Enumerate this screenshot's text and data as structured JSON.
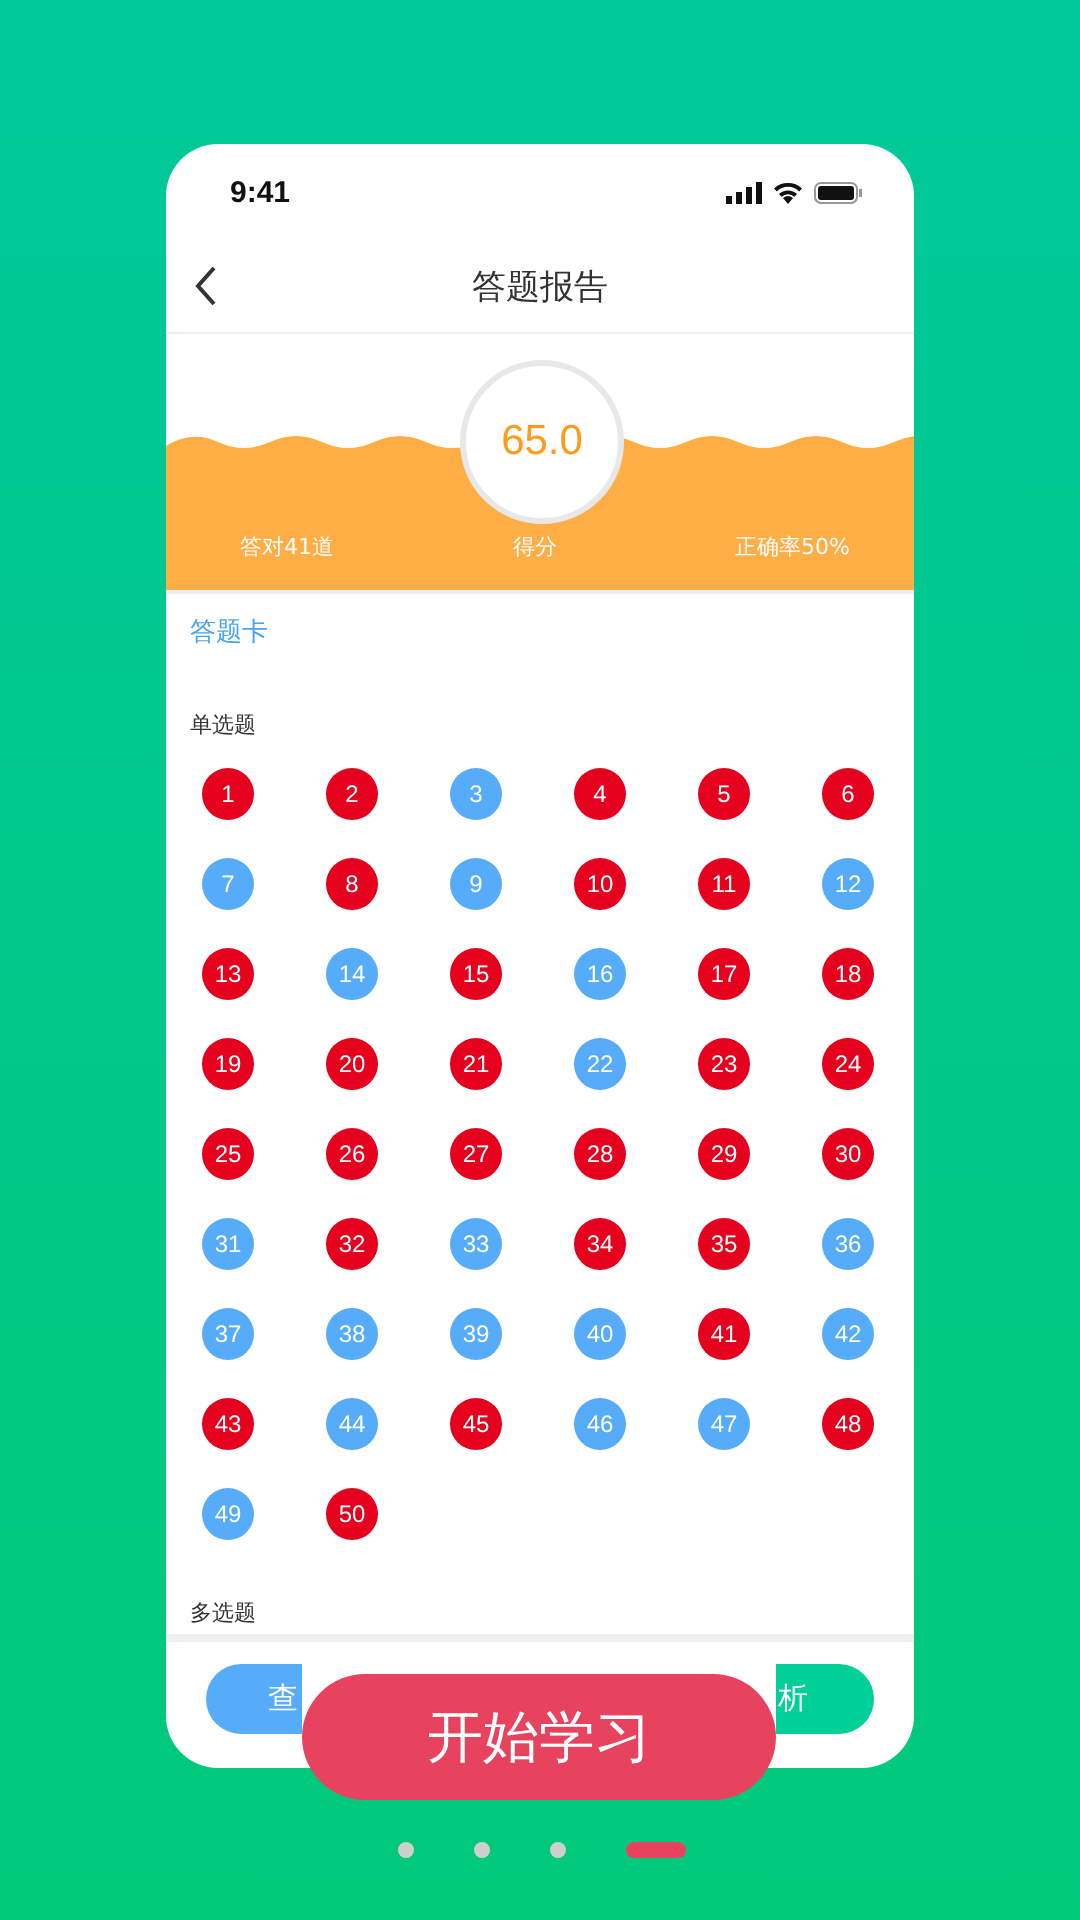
{
  "status_bar": {
    "time": "9:41"
  },
  "nav": {
    "title": "答题报告"
  },
  "score": {
    "value": "65.0",
    "correct_label": "答对41道",
    "score_label": "得分",
    "rate_label": "正确率50%"
  },
  "answer_card": {
    "title": "答题卡"
  },
  "sections": [
    {
      "title": "单选题",
      "questions": [
        {
          "number": "1",
          "correct": false
        },
        {
          "number": "2",
          "correct": false
        },
        {
          "number": "3",
          "correct": true
        },
        {
          "number": "4",
          "correct": false
        },
        {
          "number": "5",
          "correct": false
        },
        {
          "number": "6",
          "correct": false
        },
        {
          "number": "7",
          "correct": true
        },
        {
          "number": "8",
          "correct": false
        },
        {
          "number": "9",
          "correct": true
        },
        {
          "number": "10",
          "correct": false
        },
        {
          "number": "11",
          "correct": false
        },
        {
          "number": "12",
          "correct": true
        },
        {
          "number": "13",
          "correct": false
        },
        {
          "number": "14",
          "correct": true
        },
        {
          "number": "15",
          "correct": false
        },
        {
          "number": "16",
          "correct": true
        },
        {
          "number": "17",
          "correct": false
        },
        {
          "number": "18",
          "correct": false
        },
        {
          "number": "19",
          "correct": false
        },
        {
          "number": "20",
          "correct": false
        },
        {
          "number": "21",
          "correct": false
        },
        {
          "number": "22",
          "correct": true
        },
        {
          "number": "23",
          "correct": false
        },
        {
          "number": "24",
          "correct": false
        },
        {
          "number": "25",
          "correct": false
        },
        {
          "number": "26",
          "correct": false
        },
        {
          "number": "27",
          "correct": false
        },
        {
          "number": "28",
          "correct": false
        },
        {
          "number": "29",
          "correct": false
        },
        {
          "number": "30",
          "correct": false
        },
        {
          "number": "31",
          "correct": true
        },
        {
          "number": "32",
          "correct": false
        },
        {
          "number": "33",
          "correct": true
        },
        {
          "number": "34",
          "correct": false
        },
        {
          "number": "35",
          "correct": false
        },
        {
          "number": "36",
          "correct": true
        },
        {
          "number": "37",
          "correct": true
        },
        {
          "number": "38",
          "correct": true
        },
        {
          "number": "39",
          "correct": true
        },
        {
          "number": "40",
          "correct": true
        },
        {
          "number": "41",
          "correct": false
        },
        {
          "number": "42",
          "correct": true
        },
        {
          "number": "43",
          "correct": false
        },
        {
          "number": "44",
          "correct": true
        },
        {
          "number": "45",
          "correct": false
        },
        {
          "number": "46",
          "correct": true
        },
        {
          "number": "47",
          "correct": true
        },
        {
          "number": "48",
          "correct": false
        },
        {
          "number": "49",
          "correct": true
        },
        {
          "number": "50",
          "correct": false
        }
      ]
    },
    {
      "title": "多选题"
    }
  ],
  "footer_buttons": [
    {
      "label": "查",
      "kind": "left"
    },
    {
      "label": "析",
      "kind": "right"
    }
  ],
  "cta": {
    "label": "开始学习"
  },
  "pager": [
    {
      "selected": false
    },
    {
      "selected": false
    },
    {
      "selected": false
    },
    {
      "selected": true
    }
  ]
}
